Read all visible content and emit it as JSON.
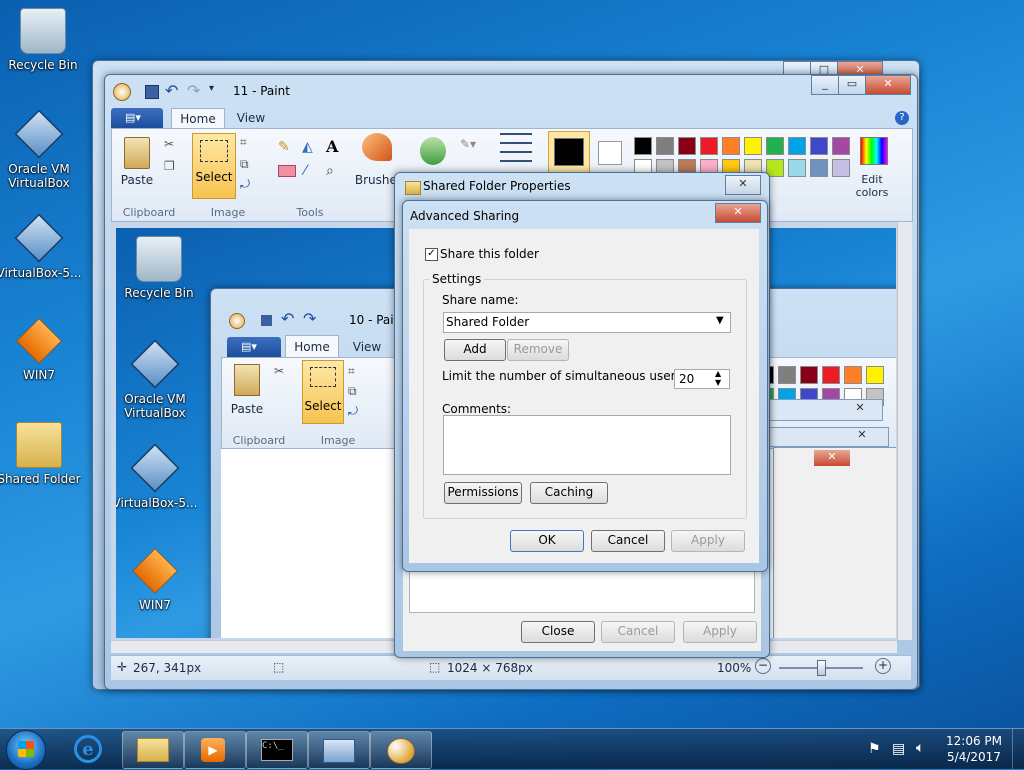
{
  "desktop": {
    "icons": [
      {
        "label": "Recycle Bin"
      },
      {
        "label": "Oracle VM VirtualBox"
      },
      {
        "label": "VirtualBox-5..."
      },
      {
        "label": "WIN7"
      },
      {
        "label": "Shared Folder"
      }
    ]
  },
  "paint_outer": {
    "title": "11 - Paint",
    "tabs": [
      "Home",
      "View"
    ],
    "buttons": {
      "paste": "Paste",
      "select": "Select",
      "brushes": "Brushes",
      "edit_colors": "Edit colors"
    },
    "groups": {
      "clipboard": "Clipboard",
      "image": "Image",
      "tools": "Tools"
    },
    "status": {
      "cursor": "267, 341px",
      "size": "1024 × 768px",
      "zoom": "100%"
    },
    "palette": [
      "#000000",
      "#7f7f7f",
      "#880015",
      "#ed1c24",
      "#ff7f27",
      "#fff200",
      "#22b14c",
      "#00a2e8",
      "#3f48cc",
      "#a349a4",
      "#ffffff",
      "#c3c3c3",
      "#b97a57",
      "#ffaec9",
      "#ffc90e",
      "#efe4b0",
      "#b5e61d",
      "#99d9ea",
      "#7092be",
      "#c8bfe7"
    ]
  },
  "paint_inner": {
    "title": "10 - Paint",
    "tabs": [
      "Home",
      "View"
    ],
    "buttons": {
      "paste": "Paste",
      "select": "Select"
    },
    "groups": {
      "clipboard": "Clipboard",
      "image": "Image"
    },
    "desktop_icons": [
      {
        "label": "Recycle Bin"
      },
      {
        "label": "Oracle VM VirtualBox"
      },
      {
        "label": "VirtualBox-5..."
      },
      {
        "label": "WIN7"
      }
    ]
  },
  "shared_props": {
    "title": "Shared Folder Properties",
    "buttons": {
      "close": "Close",
      "cancel": "Cancel",
      "apply": "Apply"
    }
  },
  "advanced_sharing": {
    "title": "Advanced Sharing",
    "share_checkbox": "Share this folder",
    "settings_group": "Settings",
    "share_name_label": "Share name:",
    "share_name_value": "Shared Folder",
    "add": "Add",
    "remove": "Remove",
    "limit_label": "Limit the number of simultaneous users to:",
    "limit_value": "20",
    "comments_label": "Comments:",
    "permissions": "Permissions",
    "caching": "Caching",
    "ok": "OK",
    "cancel": "Cancel",
    "apply": "Apply"
  },
  "taskbar": {
    "clock_time": "12:06 PM",
    "clock_date": "5/4/2017"
  }
}
